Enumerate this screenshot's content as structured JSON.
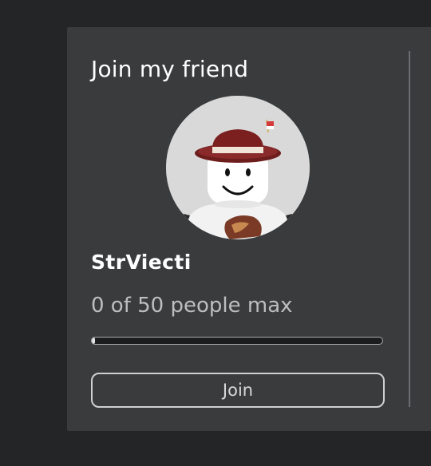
{
  "card": {
    "title": "Join my friend",
    "username": "StrViecti",
    "capacity_text": "0 of 50 people max",
    "capacity": {
      "current": 0,
      "max": 50
    },
    "join_label": "Join"
  },
  "colors": {
    "background": "#232527",
    "card": "#393b3d",
    "text_primary": "#ffffff",
    "text_secondary": "#bdbebe"
  },
  "icons": {
    "avatar": "roblox-avatar-with-fedora"
  }
}
